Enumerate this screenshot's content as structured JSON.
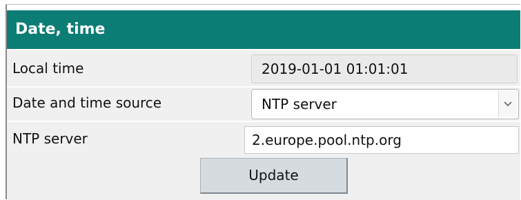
{
  "section": {
    "title": "Date, time"
  },
  "rows": {
    "local_time": {
      "label": "Local time",
      "value": "2019-01-01 01:01:01"
    },
    "source": {
      "label": "Date and time source",
      "selected": "NTP server"
    },
    "ntp": {
      "label": "NTP server",
      "value": "2.europe.pool.ntp.org"
    }
  },
  "actions": {
    "update_label": "Update"
  },
  "colors": {
    "header_bg": "#0b7d75",
    "row_bg": "#f0f0f0",
    "button_bg": "#d6dbe0"
  },
  "icons": {
    "dropdown": "chevron-down-icon"
  }
}
